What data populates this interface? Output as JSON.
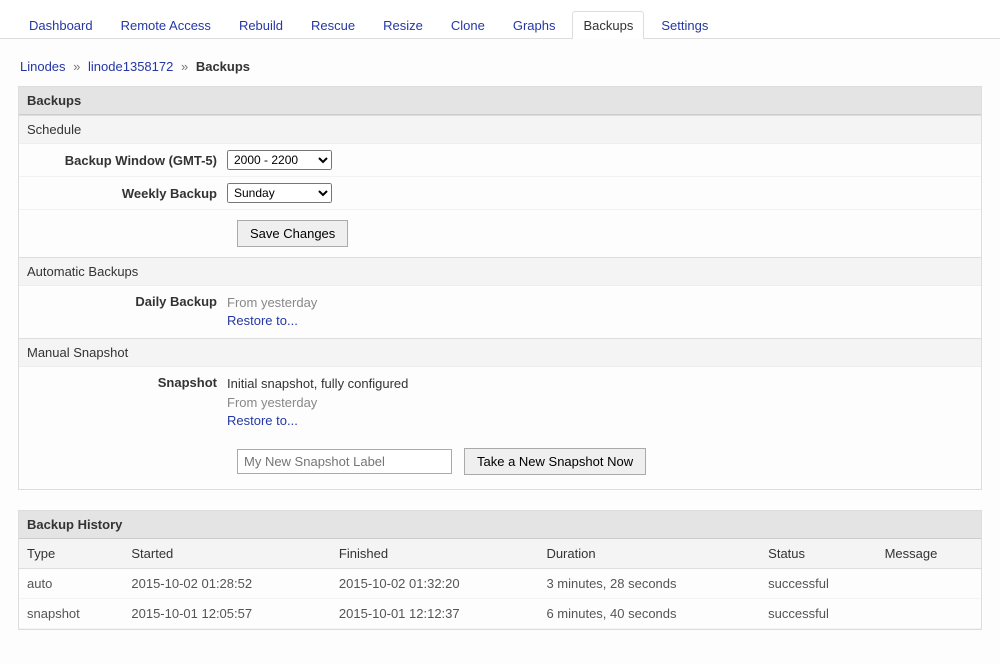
{
  "tabs": [
    {
      "label": "Dashboard",
      "active": false
    },
    {
      "label": "Remote Access",
      "active": false
    },
    {
      "label": "Rebuild",
      "active": false
    },
    {
      "label": "Rescue",
      "active": false
    },
    {
      "label": "Resize",
      "active": false
    },
    {
      "label": "Clone",
      "active": false
    },
    {
      "label": "Graphs",
      "active": false
    },
    {
      "label": "Backups",
      "active": true
    },
    {
      "label": "Settings",
      "active": false
    }
  ],
  "breadcrumb": {
    "root": "Linodes",
    "sep": "»",
    "node": "linode1358172",
    "current": "Backups"
  },
  "panel_title": "Backups",
  "schedule": {
    "header": "Schedule",
    "window_label": "Backup Window (GMT-5)",
    "window_value": "2000 - 2200",
    "weekly_label": "Weekly Backup",
    "weekly_value": "Sunday",
    "save_label": "Save Changes"
  },
  "auto": {
    "header": "Automatic Backups",
    "daily_label": "Daily Backup",
    "daily_when": "From yesterday",
    "restore_label": "Restore to..."
  },
  "manual": {
    "header": "Manual Snapshot",
    "snapshot_label": "Snapshot",
    "desc": "Initial snapshot, fully configured",
    "when": "From yesterday",
    "restore_label": "Restore to...",
    "placeholder": "My New Snapshot Label",
    "button_label": "Take a New Snapshot Now"
  },
  "history": {
    "title": "Backup History",
    "cols": {
      "type": "Type",
      "started": "Started",
      "finished": "Finished",
      "duration": "Duration",
      "status": "Status",
      "message": "Message"
    },
    "rows": [
      {
        "type": "auto",
        "started": "2015-10-02 01:28:52",
        "finished": "2015-10-02 01:32:20",
        "duration": "3 minutes, 28 seconds",
        "status": "successful",
        "message": ""
      },
      {
        "type": "snapshot",
        "started": "2015-10-01 12:05:57",
        "finished": "2015-10-01 12:12:37",
        "duration": "6 minutes, 40 seconds",
        "status": "successful",
        "message": ""
      }
    ]
  }
}
